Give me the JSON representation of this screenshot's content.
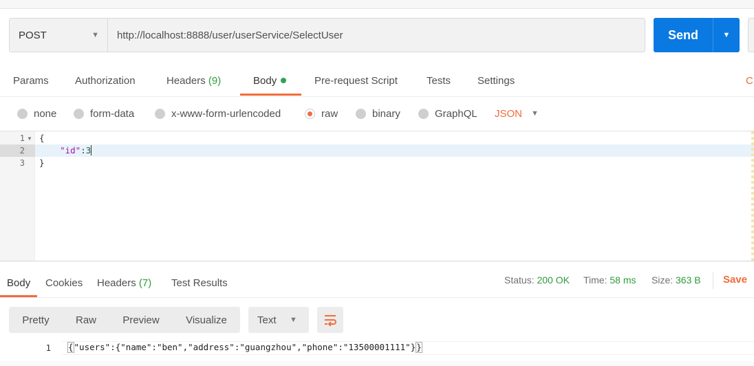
{
  "request": {
    "method": "POST",
    "url": "http://localhost:8888/user/userService/SelectUser",
    "send_label": "Send"
  },
  "request_tabs": {
    "params": "Params",
    "authorization": "Authorization",
    "headers": "Headers",
    "headers_count": "(9)",
    "body": "Body",
    "pre_request": "Pre-request Script",
    "tests": "Tests",
    "settings": "Settings",
    "cut_right": "C"
  },
  "body_types": {
    "none": "none",
    "form_data": "form-data",
    "urlencoded": "x-www-form-urlencoded",
    "raw": "raw",
    "binary": "binary",
    "graphql": "GraphQL",
    "language": "JSON",
    "selected": "raw"
  },
  "editor": {
    "line_numbers": [
      "1",
      "2",
      "3"
    ],
    "line1": "{",
    "line2_indent": "    ",
    "line2_key": "\"id\"",
    "line2_colon": ":",
    "line2_value": "3",
    "line3": "}"
  },
  "response_tabs": {
    "body": "Body",
    "cookies": "Cookies",
    "headers": "Headers",
    "headers_count": "(7)",
    "test_results": "Test Results"
  },
  "response_meta": {
    "status_label": "Status:",
    "status_value": "200 OK",
    "time_label": "Time:",
    "time_value": "58 ms",
    "size_label": "Size:",
    "size_value": "363 B",
    "save_label": "Save"
  },
  "response_view": {
    "modes": [
      "Pretty",
      "Raw",
      "Preview",
      "Visualize"
    ],
    "format": "Text"
  },
  "response_body": {
    "line_number": "1",
    "open_brace": "{",
    "content": "\"users\":{\"name\":\"ben\",\"address\":\"guangzhou\",\"phone\":\"13500001111\"}",
    "close_brace": "}"
  },
  "colors": {
    "accent_orange": "#f26b3a",
    "send_blue": "#0a79e1",
    "success_green": "#2c9c3c"
  }
}
